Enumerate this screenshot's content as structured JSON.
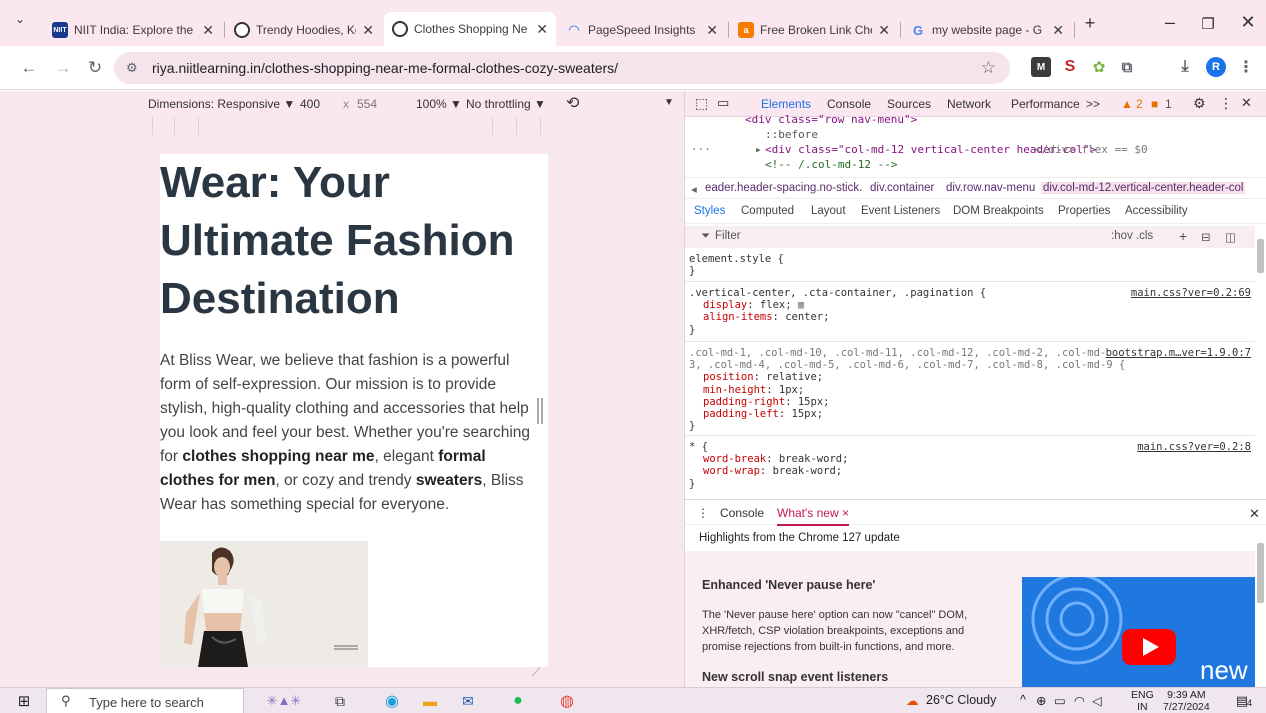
{
  "tabs": [
    {
      "title": "NIIT India: Explore the",
      "favicon_text": "NIIT",
      "favicon_color": "#1a3a8c",
      "active": false
    },
    {
      "title": "Trendy Hoodies, Kore",
      "favicon_text": "",
      "favicon_color": "#333333",
      "active": false
    },
    {
      "title": "Clothes Shopping Ne",
      "favicon_text": "",
      "favicon_color": "#333333",
      "active": true
    },
    {
      "title": "PageSpeed Insights",
      "favicon_text": "",
      "favicon_color": "#1a73e8",
      "active": false
    },
    {
      "title": "Free Broken Link Che",
      "favicon_text": "a",
      "favicon_color": "#f57c00",
      "active": false
    },
    {
      "title": "my website page - G",
      "favicon_text": "G",
      "favicon_color": "#4285f4",
      "active": false
    }
  ],
  "address_bar": {
    "url": "riya.niitlearning.in/clothes-shopping-near-me-formal-clothes-cozy-sweaters/"
  },
  "profile_initial": "R",
  "device_toolbar": {
    "dimensions_label": "Dimensions: Responsive ▼",
    "width": "400",
    "times": "x",
    "height": "554",
    "zoom": "100% ▼",
    "throttling": "No throttling ▼"
  },
  "page": {
    "heading": "Wear: Your Ultimate Fashion Destination",
    "para_1": "At Bliss Wear, we believe that fashion is a powerful form of self-expression. Our mission is to provide stylish, high-quality clothing and accessories that help you look and feel your best. Whether you're searching for ",
    "bold_1": "clothes shopping near me",
    "para_2": ", elegant ",
    "bold_2": "formal clothes for men",
    "para_3": ", or cozy and trendy ",
    "bold_3": "sweaters",
    "para_4": ", Bliss Wear has something special for everyone."
  },
  "devtools": {
    "tabs": [
      "Elements",
      "Console",
      "Sources",
      "Network",
      "Performance",
      ">>"
    ],
    "warnings": "2",
    "issues": "1",
    "dom": {
      "line_1": "<div class=\"row nav-menu\">",
      "line_2": "::before",
      "line_3": "<div class=\"col-md-12 vertical-center header-col\">",
      "line_3_tail": "</div> flex == $0",
      "line_4": "<!-- /.col-md-12 -->"
    },
    "breadcrumbs": [
      "eader.header-spacing.no-stick.",
      "div.container",
      "div.row.nav-menu",
      "div.col-md-12.vertical-center.header-col"
    ],
    "subtabs": [
      "Styles",
      "Computed",
      "Layout",
      "Event Listeners",
      "DOM Breakpoints",
      "Properties",
      "Accessibility"
    ],
    "filter_placeholder": "Filter",
    "filter_tools": ":hov .cls",
    "rules": {
      "r0_selector": "element.style {",
      "r1_selector": ".vertical-center, .cta-container, .pagination {",
      "r1_source": "main.css?ver=0.2:69",
      "r1_p1": "display",
      "r1_v1": "flex;",
      "r1_p2": "align-items",
      "r1_v2": "center;",
      "r2_selector_a": ".col-md-1, .col-md-10, .col-md-11, .col-md-12, .col-md-2, .col-md-",
      "r2_selector_b": "3, .col-md-4, .col-md-5, .col-md-6, .col-md-7, .col-md-8, .col-md-9 {",
      "r2_source": "bootstrap.m…ver=1.9.0:7",
      "r2_p1": "position",
      "r2_v1": "relative;",
      "r2_p2": "min-height",
      "r2_v2": "1px;",
      "r2_p3": "padding-right",
      "r2_v3": "15px;",
      "r2_p4": "padding-left",
      "r2_v4": "15px;",
      "r3_selector": "* {",
      "r3_source": "main.css?ver=0.2:8",
      "r3_p1": "word-break",
      "r3_v1": "break-word;",
      "r3_p2": "word-wrap",
      "r3_v2": "break-word;",
      "close": "}"
    },
    "drawer": {
      "console_tab": "Console",
      "whats_new_tab": "What's new ×",
      "highlight": "Highlights from the Chrome 127 update",
      "item1_title": "Enhanced 'Never pause here'",
      "item1_text": "The 'Never pause here' option can now \"cancel\" DOM, XHR/fetch, CSP violation breakpoints, exceptions and promise rejections from built-in functions, and more.",
      "item2_title": "New scroll snap event listeners",
      "banner_text": "new"
    }
  },
  "taskbar": {
    "search_placeholder": "Type here to search",
    "weather": "26°C  Cloudy",
    "lang": "ENG",
    "lang_sub": "IN",
    "time": "9:39 AM",
    "date": "7/27/2024",
    "notifications": "4"
  },
  "colors": {
    "accent": "#1a73e8",
    "tab_strip": "#fbe7ef",
    "heading": "#2a3642",
    "dom_tag": "#881280"
  }
}
